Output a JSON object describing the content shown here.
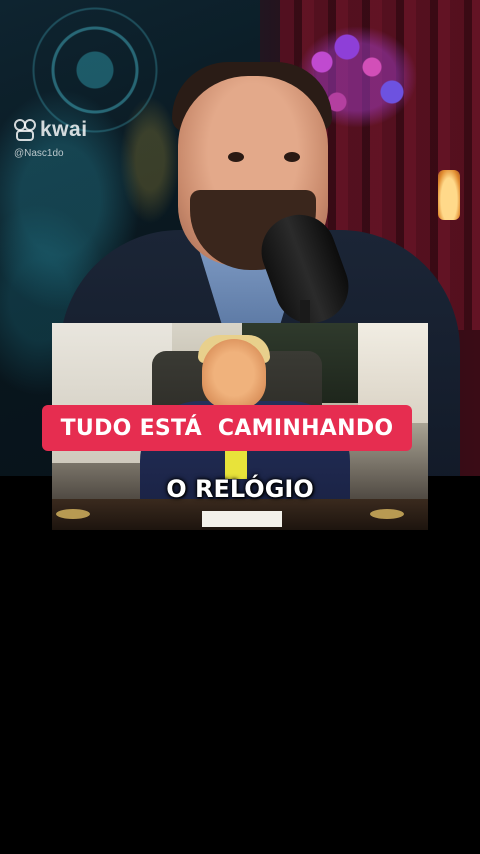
{
  "watermark": {
    "brand": "kwai",
    "icon": "kwai-icon",
    "handle": "@Nasc1do"
  },
  "captions": {
    "top": "TUDO ESTÁ  CAMINHANDO",
    "bottom": "O RELÓGIO"
  },
  "colors": {
    "caption_highlight": "#e62d50",
    "background": "#000000"
  }
}
